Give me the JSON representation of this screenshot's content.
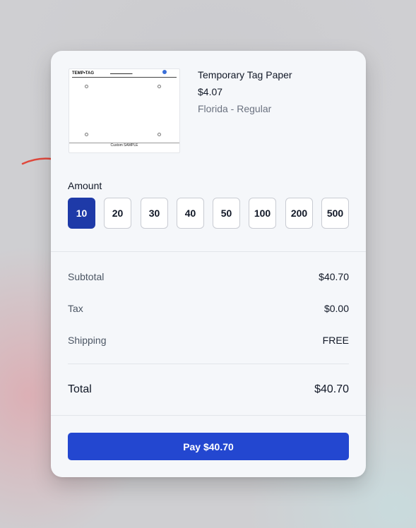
{
  "product": {
    "name": "Temporary Tag Paper",
    "price": "$4.07",
    "variant": "Florida - Regular",
    "thumbnail": {
      "brand": "TEMP•TAG",
      "footer": "Custom SAMPLE"
    }
  },
  "amount": {
    "label": "Amount",
    "options": [
      "10",
      "20",
      "30",
      "40",
      "50",
      "100",
      "200",
      "500"
    ],
    "selected": "10"
  },
  "summary": {
    "subtotal_label": "Subtotal",
    "subtotal_value": "$40.70",
    "tax_label": "Tax",
    "tax_value": "$0.00",
    "shipping_label": "Shipping",
    "shipping_value": "FREE",
    "total_label": "Total",
    "total_value": "$40.70"
  },
  "pay_button": {
    "label": "Pay $40.70"
  },
  "colors": {
    "accent": "#2347d0",
    "selected_amount": "#1e3aa8",
    "annotation_arrow": "#e0483c"
  }
}
